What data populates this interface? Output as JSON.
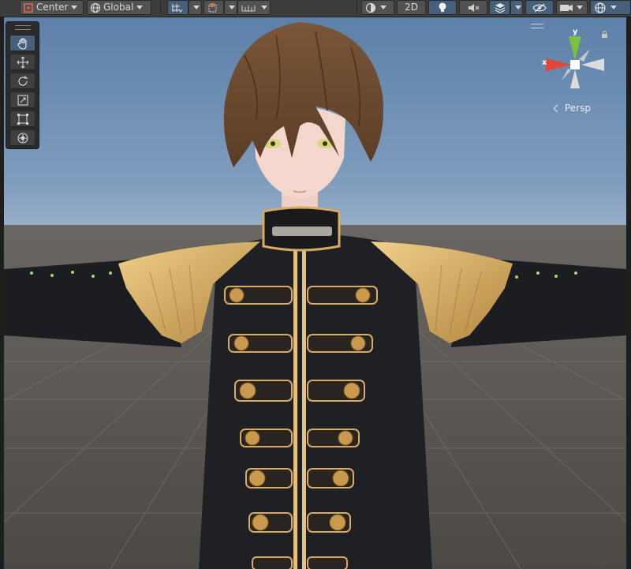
{
  "toolbar": {
    "pivot_label": "Center",
    "rotation_label": "Global",
    "mode_2d_label": "2D"
  },
  "icons": {
    "pivot": "pivot-center-icon",
    "rotation": "globe-icon",
    "grid": "grid-snap-icon",
    "increment": "increment-snap-icon",
    "ruler": "ruler-icon",
    "shading": "shading-mode-icon",
    "lighting": "lightbulb-icon",
    "audio": "audio-mute-icon",
    "effects": "scene-effects-icon",
    "visibility": "visibility-eye-icon",
    "camera": "camera-icon",
    "gizmos": "gizmos-globe-icon"
  },
  "tools": [
    "hand-tool",
    "move-tool",
    "rotate-tool",
    "scale-tool",
    "rect-tool",
    "transform-tool"
  ],
  "gizmo": {
    "x_label": "x",
    "y_label": "y",
    "projection_label": "Persp"
  },
  "colors": {
    "toolbar_bg": "#3c3c3c",
    "active_button": "#46607c",
    "sky_top": "#5d80a9",
    "horizon": "#b8c6cd",
    "ground": "#58544f",
    "axis_x": "#e0463a",
    "axis_y": "#7ac13d",
    "jacket": "#1f2024",
    "gold": "#d7ab62",
    "hair": "#6b4a32",
    "skin": "#f3d6cc"
  }
}
